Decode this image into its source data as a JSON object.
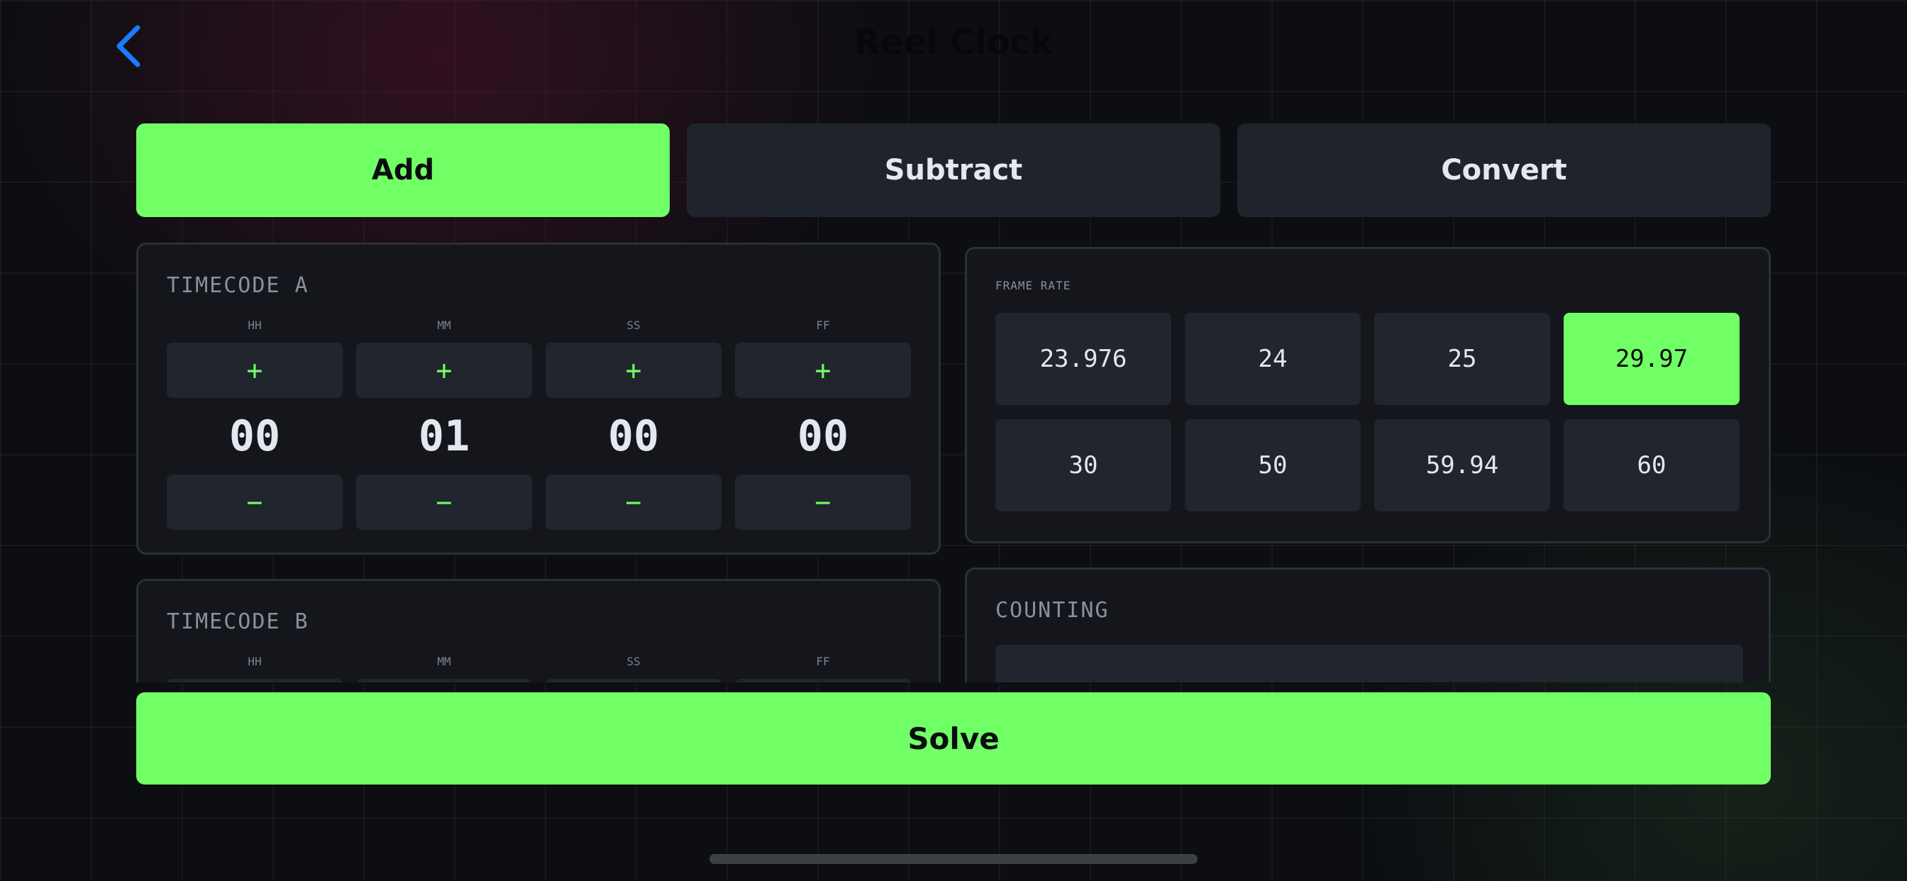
{
  "header": {
    "title": "Reel Clock",
    "back_icon": "chevron-left-icon"
  },
  "tabs": [
    {
      "label": "Add",
      "active": true
    },
    {
      "label": "Subtract",
      "active": false
    },
    {
      "label": "Convert",
      "active": false
    }
  ],
  "timecode_a": {
    "label": "TIMECODE A",
    "fields": [
      {
        "unit": "HH",
        "value": "00",
        "plus": "+",
        "minus": "−"
      },
      {
        "unit": "MM",
        "value": "01",
        "plus": "+",
        "minus": "−"
      },
      {
        "unit": "SS",
        "value": "00",
        "plus": "+",
        "minus": "−"
      },
      {
        "unit": "FF",
        "value": "00",
        "plus": "+",
        "minus": "−"
      }
    ]
  },
  "timecode_b": {
    "label": "TIMECODE B",
    "fields": [
      {
        "unit": "HH"
      },
      {
        "unit": "MM"
      },
      {
        "unit": "SS"
      },
      {
        "unit": "FF"
      }
    ]
  },
  "frame_rate": {
    "label": "FRAME RATE",
    "options": [
      "23.976",
      "24",
      "25",
      "29.97",
      "30",
      "50",
      "59.94",
      "60"
    ],
    "selected": "29.97"
  },
  "counting": {
    "label": "COUNTING"
  },
  "solve_label": "Solve",
  "colors": {
    "accent": "#71ff66",
    "back_icon": "#1a7cff",
    "panel": "#14161c",
    "button": "#21252d"
  }
}
